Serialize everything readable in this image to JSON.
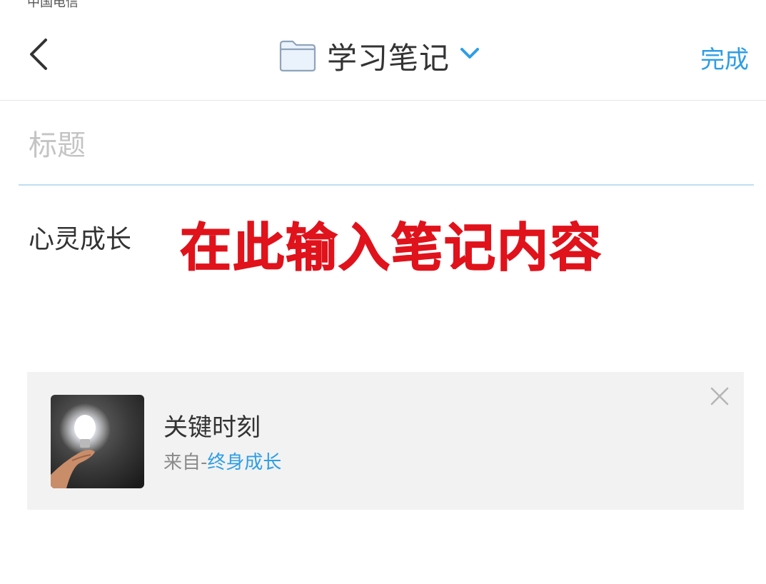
{
  "status_bar": {
    "carrier": "中国电信"
  },
  "nav": {
    "folder_name": "学习笔记",
    "done_label": "完成"
  },
  "editor": {
    "title_placeholder": "标题",
    "title_value": "",
    "body_text": "心灵成长",
    "overlay_annotation": "在此输入笔记内容"
  },
  "reference_card": {
    "title": "关键时刻",
    "source_prefix": "来自-",
    "source_name": "终身成长",
    "thumbnail": "light-bulb-in-hand-image"
  },
  "colors": {
    "accent": "#2e9ee6",
    "annotation_red": "#e0121b",
    "card_background": "#f2f2f2",
    "divider": "#bfdff0"
  },
  "icons": {
    "back": "chevron-left-icon",
    "folder": "folder-icon",
    "dropdown": "chevron-down-icon",
    "close": "close-icon"
  }
}
